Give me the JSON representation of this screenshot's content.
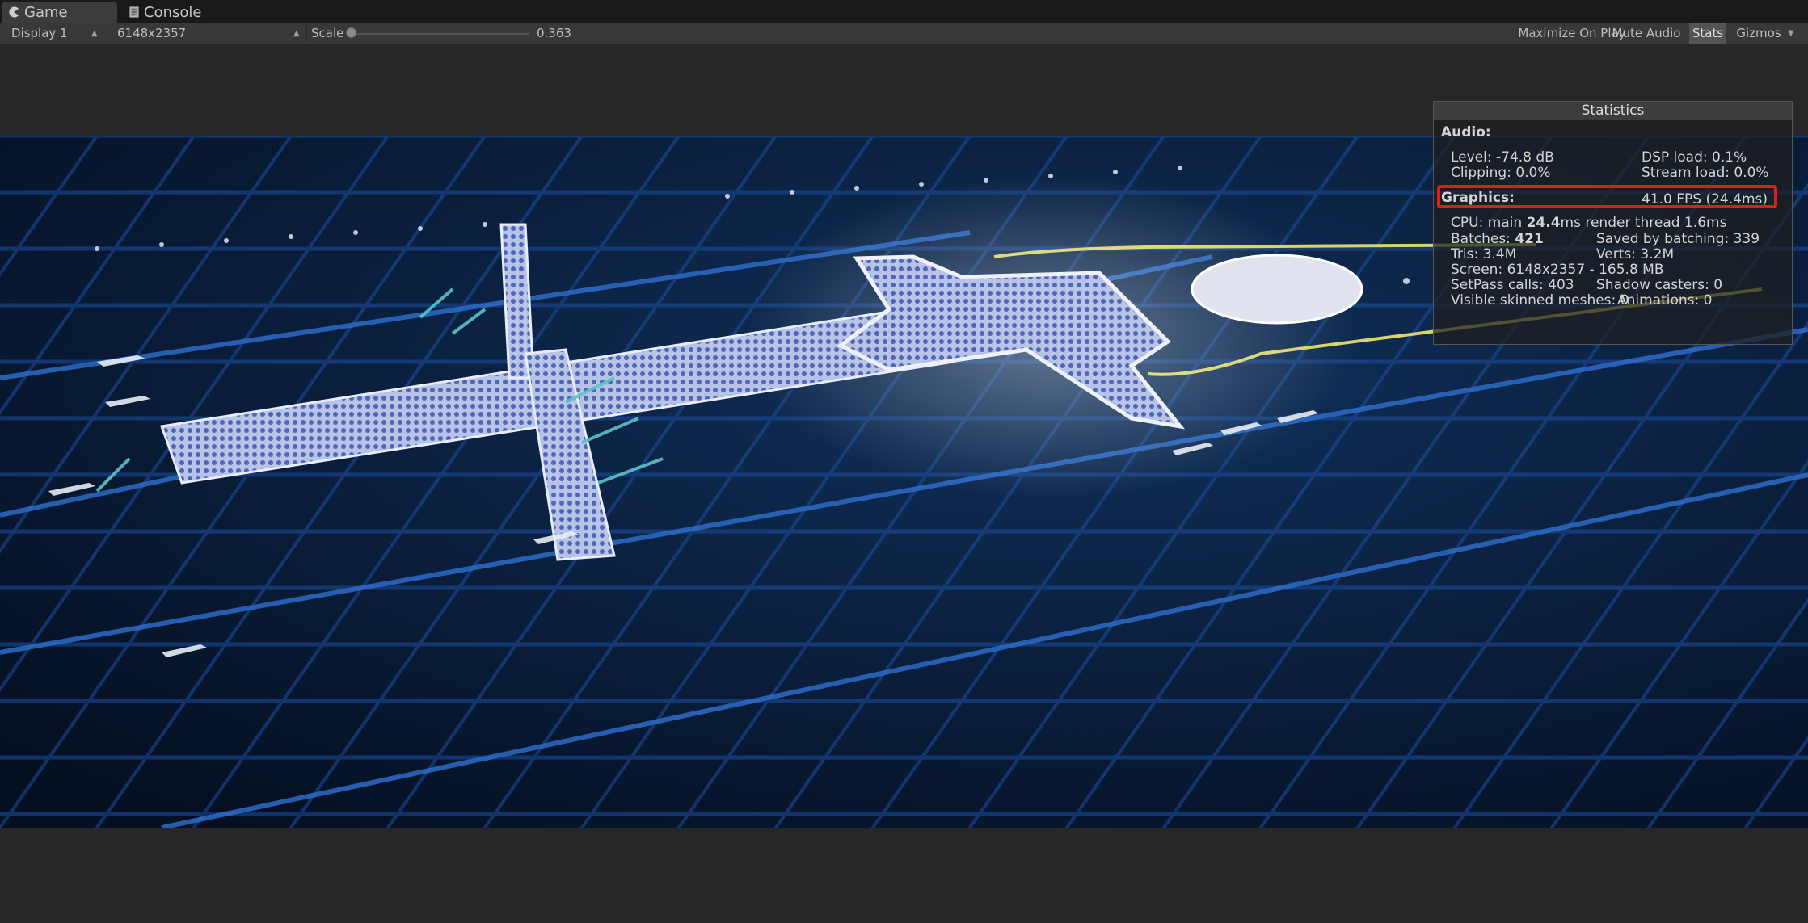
{
  "tabs": [
    {
      "label": "Game",
      "icon": "pacman-icon",
      "active": true
    },
    {
      "label": "Console",
      "icon": "console-icon",
      "active": false
    }
  ],
  "toolbar": {
    "display": "Display 1",
    "resolution": "6148x2357",
    "scale_label": "Scale",
    "scale_value": "0.363",
    "maximize_on_play": "Maximize On Play",
    "mute_audio": "Mute Audio",
    "stats": "Stats",
    "gizmos": "Gizmos"
  },
  "statistics": {
    "title": "Statistics",
    "audio": {
      "heading": "Audio:",
      "level": "Level: -74.8 dB",
      "clipping": "Clipping: 0.0%",
      "dsp_load": "DSP load: 0.1%",
      "stream_load": "Stream load: 0.0%"
    },
    "graphics": {
      "heading": "Graphics:",
      "fps": "41.0 FPS (24.4ms)",
      "cpu_prefix": "CPU: main ",
      "cpu_main": "24.4",
      "cpu_suffix": "ms  render thread 1.6ms",
      "batches_label": "Batches: ",
      "batches_value": "421",
      "saved_by_batching": "Saved by batching: 339",
      "tris": "Tris: 3.4M",
      "verts": "Verts: 3.2M",
      "screen": "Screen: 6148x2357 - 165.8 MB",
      "setpass": "SetPass calls: 403",
      "shadow_casters": "Shadow casters: 0",
      "skinned_meshes": "Visible skinned meshes: 0",
      "animations": "Animations: 0"
    }
  },
  "colors": {
    "highlight": "#e21b1b",
    "scene_background": "#07162b",
    "terminal_blue": "#6d86c9"
  }
}
